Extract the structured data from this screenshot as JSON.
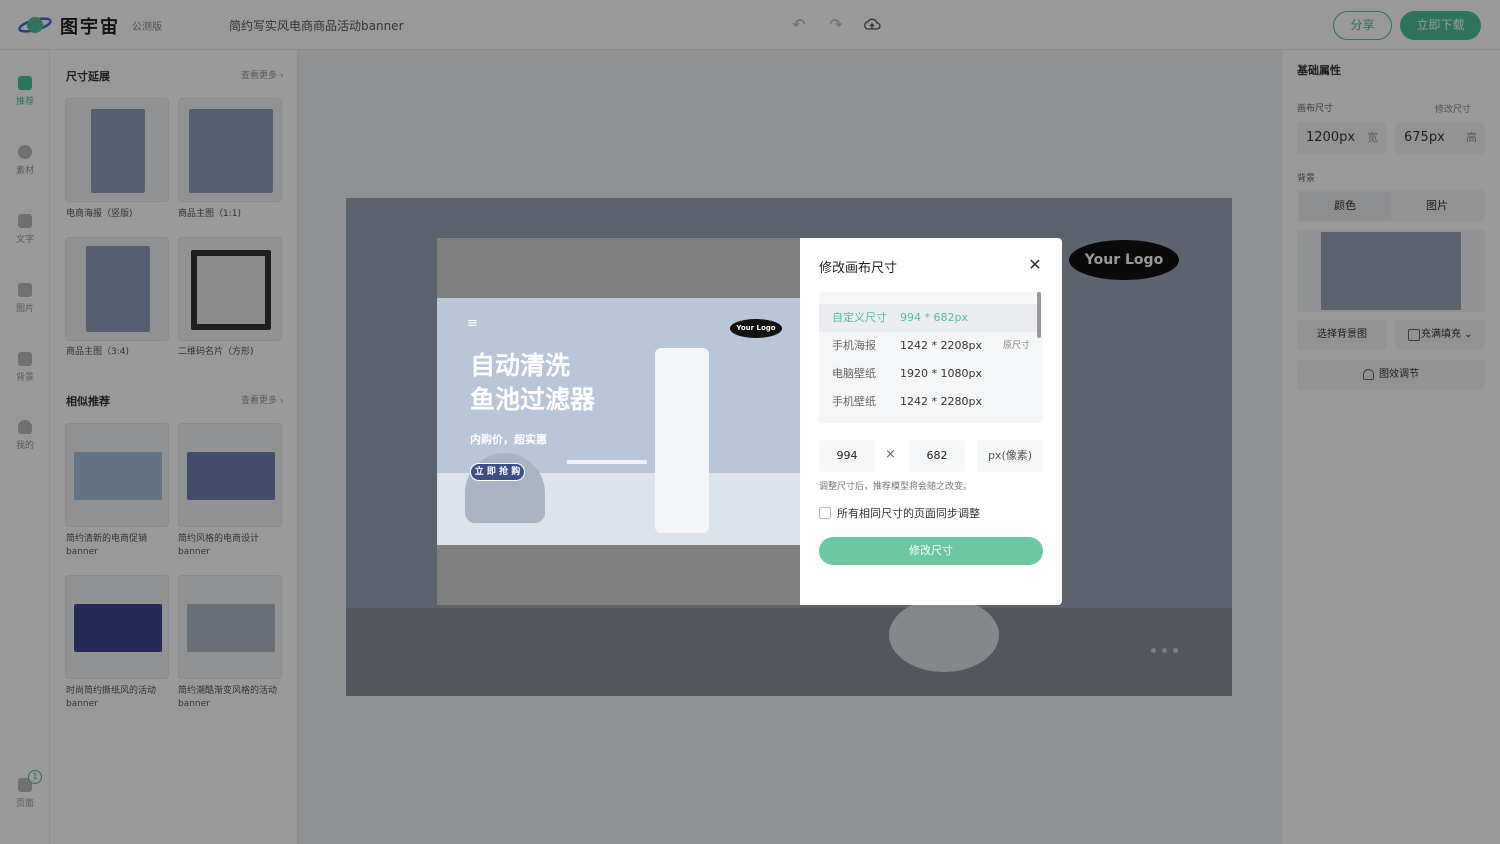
{
  "app": {
    "name": "图宇宙",
    "edition": "公测版",
    "doc_title": "简约写实风电商商品活动banner"
  },
  "header": {
    "undo_icon": "undo-icon",
    "redo_icon": "redo-icon",
    "cloud_icon": "cloud-upload-icon",
    "share_label": "分享",
    "download_label": "立即下载"
  },
  "leftnav": {
    "items": [
      {
        "label": "推荐",
        "icon": "template-icon",
        "active": true
      },
      {
        "label": "素材",
        "icon": "shapes-icon"
      },
      {
        "label": "文字",
        "icon": "text-icon"
      },
      {
        "label": "图片",
        "icon": "image-icon"
      },
      {
        "label": "背景",
        "icon": "background-icon"
      },
      {
        "label": "我的",
        "icon": "user-icon"
      }
    ],
    "pages_label": "页面",
    "pages_count": "1"
  },
  "panel": {
    "section1": {
      "title": "尺寸延展",
      "more": "查看更多 ›",
      "items": [
        "电商海报（竖版)",
        "商品主图（1:1)",
        "商品主图（3:4)",
        "二维码名片（方形)"
      ]
    },
    "section2": {
      "title": "相似推荐",
      "more": "查看更多 ›",
      "items": [
        "简约清新的电商促销\nbanner",
        "简约风格的电商设计\nbanner",
        "时尚简约撕纸风的活动\nbanner",
        "简约潮酷渐变风格的活动\nbanner"
      ]
    }
  },
  "canvas": {
    "logo_text": "Your Logo"
  },
  "right": {
    "title": "基础属性",
    "canvas_size_label": "画布尺寸",
    "resize_link": "修改尺寸",
    "width_value": "1200px",
    "width_unit": "宽",
    "height_value": "675px",
    "height_unit": "高",
    "bg_label": "背景",
    "tab_color": "颜色",
    "tab_image": "图片",
    "choose_bg": "选择背景图",
    "fill_mode": "充满填充 ⌄",
    "effect_label": "图效调节"
  },
  "dialog": {
    "title": "修改画布尺寸",
    "sizes": [
      {
        "name": "自定义尺寸",
        "dim": "994 * 682px",
        "tag": "",
        "selected": true
      },
      {
        "name": "手机海报",
        "dim": "1242 * 2208px",
        "tag": "原尺寸"
      },
      {
        "name": "电脑壁纸",
        "dim": "1920 * 1080px",
        "tag": ""
      },
      {
        "name": "手机壁纸",
        "dim": "1242 * 2280px",
        "tag": ""
      }
    ],
    "width_input": "994",
    "height_input": "682",
    "unit": "px(像素)",
    "hint": "调整尺寸后，推荐模型将会随之改变。",
    "checkbox_label": "所有相同尺寸的页面同步调整",
    "submit": "修改尺寸"
  },
  "preview_banner": {
    "title_line1": "自动清洗",
    "title_line2": "鱼池过滤器",
    "subtitle": "内购价，超实惠",
    "cta": "立 即 抢 购",
    "logo": "Your Logo",
    "menu_glyph": "≡"
  },
  "colors": {
    "accent": "#4fbf9b",
    "overlay": "rgba(0,0,0,0.40)"
  }
}
